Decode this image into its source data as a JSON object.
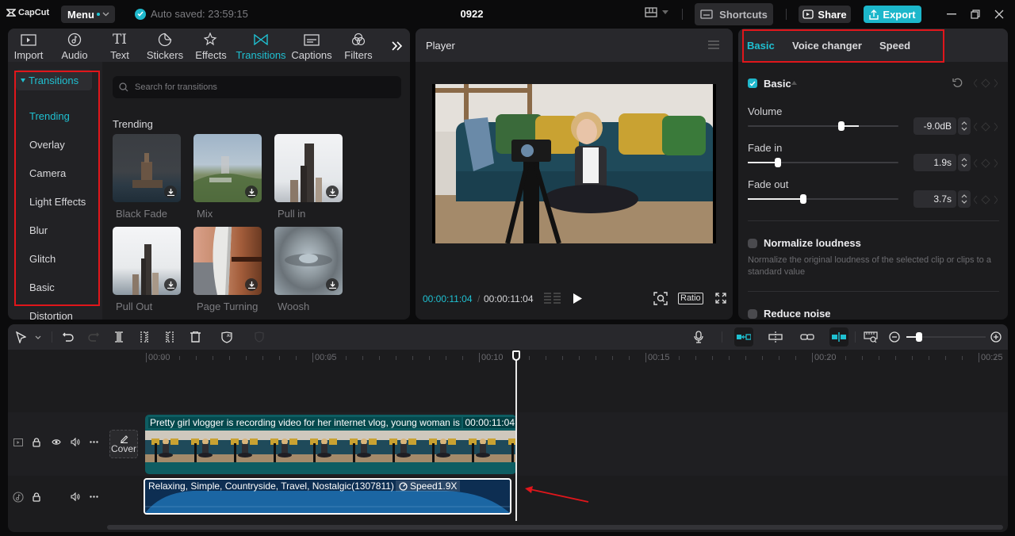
{
  "app": {
    "logo_text": "CapCut",
    "menu_label": "Menu",
    "autosave_text": "Auto saved: 23:59:15",
    "project_title": "0922",
    "shortcuts_label": "Shortcuts",
    "share_label": "Share",
    "export_label": "Export",
    "accent_color": "#1fc0d1"
  },
  "media": {
    "tools": [
      {
        "label": "Import",
        "icon": "import-icon"
      },
      {
        "label": "Audio",
        "icon": "audio-icon"
      },
      {
        "label": "Text",
        "icon": "text-icon"
      },
      {
        "label": "Stickers",
        "icon": "stickers-icon"
      },
      {
        "label": "Effects",
        "icon": "effects-icon"
      },
      {
        "label": "Transitions",
        "icon": "transitions-icon",
        "active": true
      },
      {
        "label": "Captions",
        "icon": "captions-icon"
      },
      {
        "label": "Filters",
        "icon": "filters-icon"
      }
    ],
    "categories_header": "Transitions",
    "categories": [
      "Trending",
      "Overlay",
      "Camera",
      "Light Effects",
      "Blur",
      "Glitch",
      "Basic",
      "Distortion"
    ],
    "active_category": "Trending",
    "search_placeholder": "Search for transitions",
    "section_title": "Trending",
    "transitions": [
      {
        "label": "Black Fade"
      },
      {
        "label": "Mix"
      },
      {
        "label": "Pull in"
      },
      {
        "label": "Pull Out"
      },
      {
        "label": "Page Turning"
      },
      {
        "label": "Woosh"
      }
    ]
  },
  "player": {
    "title": "Player",
    "current_time": "00:00:11:04",
    "separator": "/",
    "total_time": "00:00:11:04",
    "ratio_label": "Ratio"
  },
  "properties": {
    "tabs": [
      "Basic",
      "Voice changer",
      "Speed"
    ],
    "active_tab": "Basic",
    "section_title": "Basic",
    "volume_label": "Volume",
    "volume_value": "-9.0dB",
    "volume_level_fraction": 0.62,
    "fade_in_label": "Fade in",
    "fade_in_value": "1.9s",
    "fade_in_fraction": 0.2,
    "fade_out_label": "Fade out",
    "fade_out_value": "3.7s",
    "fade_out_fraction": 0.37,
    "normalize_label": "Normalize loudness",
    "normalize_desc": "Normalize the original loudness of the selected clip or clips to a standard value",
    "normalize_checked": false,
    "reduce_noise_label": "Reduce noise",
    "reduce_noise_checked": false
  },
  "timeline": {
    "ruler_labels": [
      "00:00",
      "00:05",
      "00:10",
      "00:15",
      "00:20",
      "00:25"
    ],
    "cover_label": "Cover",
    "video_clip": {
      "title": "Pretty girl vlogger is recording video for her internet vlog, young woman is",
      "duration": "00:00:11:04"
    },
    "audio_clip": {
      "title": "Relaxing, Simple, Countryside, Travel, Nostalgic(1307811)",
      "speed": "Speed1.9X"
    }
  }
}
